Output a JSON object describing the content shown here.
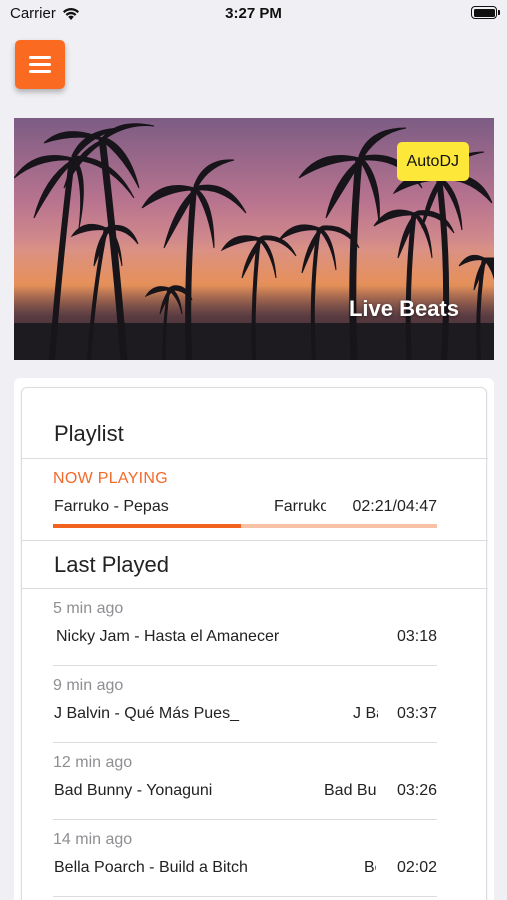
{
  "status_bar": {
    "carrier": "Carrier",
    "time": "3:27 PM"
  },
  "hero": {
    "badge": "AutoDJ",
    "station": "Live Beats"
  },
  "playlist": {
    "title": "Playlist",
    "now_playing_label": "NOW PLAYING",
    "now_playing": {
      "title": "Farruko - Pepas",
      "artist": "Farruko",
      "time": "02:21/04:47",
      "progress": 0.49
    }
  },
  "last_played": {
    "title": "Last Played",
    "items": [
      {
        "ago": "5 min ago",
        "title": "Nicky Jam - Hasta el Amanecer",
        "artist": "",
        "duration": "03:18"
      },
      {
        "ago": "9 min ago",
        "title": "J Balvin - Qué Más Pues_",
        "artist": "J Balvin",
        "duration": "03:37"
      },
      {
        "ago": "12 min ago",
        "title": "Bad Bunny - Yonaguni",
        "artist": "Bad Bunny",
        "duration": "03:26"
      },
      {
        "ago": "14 min ago",
        "title": "Bella Poarch - Build a Bitch",
        "artist": "Bella Poarch",
        "duration": "02:02"
      }
    ]
  },
  "colors": {
    "accent": "#fb6a21",
    "badge": "#fde83a",
    "muted": "#8e8e93"
  },
  "icons": {
    "menu": "hamburger-icon",
    "wifi": "wifi-icon",
    "battery": "battery-icon"
  }
}
